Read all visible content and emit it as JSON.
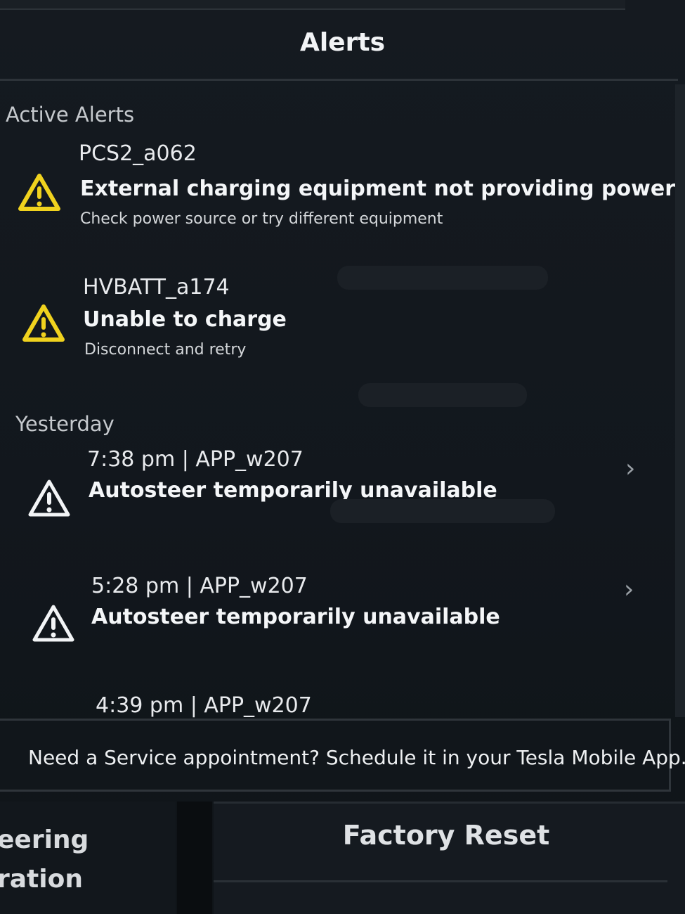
{
  "header": {
    "title": "Alerts"
  },
  "active": {
    "label": "Active Alerts",
    "alerts": [
      {
        "code": "PCS2_a062",
        "message": "External charging equipment not providing power",
        "hint": "Check power source or try different equipment",
        "icon": "warning-triangle-icon",
        "icon_color": "#f0d21e"
      },
      {
        "code": "HVBATT_a174",
        "message": "Unable to charge",
        "hint": "Disconnect and retry",
        "icon": "warning-triangle-icon",
        "icon_color": "#f0d21e"
      }
    ]
  },
  "history": {
    "label": "Yesterday",
    "alerts": [
      {
        "meta": "7:38 pm | APP_w207",
        "message": "Autosteer temporarily unavailable",
        "icon": "warning-triangle-outline-icon",
        "chevron": "›"
      },
      {
        "meta": "5:28 pm | APP_w207",
        "message": "Autosteer temporarily unavailable",
        "icon": "warning-triangle-outline-icon",
        "chevron": "›"
      },
      {
        "meta": "4:39 pm | APP_w207"
      }
    ]
  },
  "service": {
    "text": "Need a Service appointment? Schedule it in your Tesla Mobile App."
  },
  "bottom": {
    "left_line1": "eering",
    "left_line2": "ration",
    "factory_reset": "Factory Reset"
  }
}
